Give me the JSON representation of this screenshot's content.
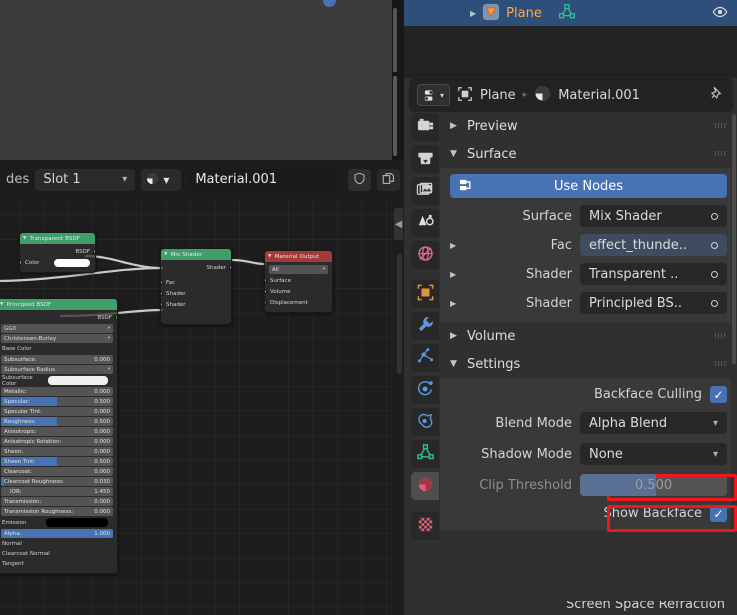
{
  "viewport": {
    "name": "3d-viewport",
    "object_outline_color": "#ff8226",
    "object_fill_color": "#b0bf4b",
    "background_color": "#3c3c3c"
  },
  "shader_editor": {
    "header": {
      "truncated_label": "des",
      "slot_selector": "Slot 1",
      "material_name": "Material.001",
      "fake_user_icon": "shield-icon",
      "new_material_icon": "copy-icon",
      "browse_material_icon": "material-sphere-icon"
    },
    "nodes": [
      {
        "id": "transparent-bsdf",
        "title": "Transparent BSDF",
        "header_color": "#3f9e69",
        "outputs": [
          "BSDF"
        ],
        "color_label": "Color",
        "color_value": "#ffffff"
      },
      {
        "id": "mix-shader",
        "title": "Mix Shader",
        "header_color": "#3f9e69",
        "outputs": [
          "Shader"
        ],
        "inputs": [
          "Fac",
          "Shader",
          "Shader"
        ]
      },
      {
        "id": "material-output",
        "title": "Material Output",
        "header_color": "#a33a3a",
        "target": "All",
        "inputs": [
          "Surface",
          "Volume",
          "Displacement"
        ]
      },
      {
        "id": "principled-bsdf",
        "title": "Principled BSDF",
        "header_color": "#3f9e69",
        "outputs": [
          "BSDF"
        ],
        "distribution": "GGX",
        "subsurface_method": "Christensen-Burley",
        "properties": [
          {
            "label": "Base Color",
            "type": "label"
          },
          {
            "label": "Subsurface:",
            "value": "0.000",
            "type": "slider",
            "fill": 0
          },
          {
            "label": "Subsurface Radius",
            "type": "dropdown"
          },
          {
            "label": "Subsurface Color",
            "type": "color",
            "color": "#f0f0ee"
          },
          {
            "label": "Metallic:",
            "value": "0.000",
            "type": "slider",
            "fill": 0
          },
          {
            "label": "Specular:",
            "value": "0.500",
            "type": "slider",
            "fill": 50
          },
          {
            "label": "Specular Tint:",
            "value": "0.000",
            "type": "slider",
            "fill": 0
          },
          {
            "label": "Roughness:",
            "value": "0.500",
            "type": "slider",
            "fill": 50
          },
          {
            "label": "Anisotropic:",
            "value": "0.000",
            "type": "slider",
            "fill": 0
          },
          {
            "label": "Anisotropic Rotation:",
            "value": "0.000",
            "type": "slider",
            "fill": 0
          },
          {
            "label": "Sheen:",
            "value": "0.000",
            "type": "slider",
            "fill": 0
          },
          {
            "label": "Sheen Tint:",
            "value": "0.500",
            "type": "slider",
            "fill": 50
          },
          {
            "label": "Clearcoat:",
            "value": "0.000",
            "type": "slider",
            "fill": 0
          },
          {
            "label": "Clearcoat Roughness:",
            "value": "0.030",
            "type": "slider",
            "fill": 3
          },
          {
            "label": "IOR:",
            "value": "1.450",
            "type": "slider",
            "fill": 0
          },
          {
            "label": "Transmission:",
            "value": "0.000",
            "type": "slider",
            "fill": 0
          },
          {
            "label": "Transmission Roughness:",
            "value": "0.000",
            "type": "slider",
            "fill": 0
          },
          {
            "label": "Emission",
            "type": "color",
            "color": "#000000"
          },
          {
            "label": "Alpha:",
            "value": "1.000",
            "type": "slider",
            "fill": 100
          },
          {
            "label": "Normal",
            "type": "label"
          },
          {
            "label": "Clearcoat Normal",
            "type": "label"
          },
          {
            "label": "Tangent",
            "type": "label"
          }
        ]
      }
    ]
  },
  "outliner": {
    "object_name": "Plane",
    "object_icon": "mesh-triangle-icon",
    "data_icon": "mesh-data-icon",
    "visibility_icon": "eye-icon",
    "highlight_color": "#2d4f79",
    "name_color": "#ffa94d"
  },
  "properties": {
    "breadcrumb": {
      "editor_icon": "properties-editor-icon",
      "object_icon": "object-data-icon",
      "object_name": "Plane",
      "separator": "▸",
      "material_icon": "material-sphere-icon",
      "material_name": "Material.001",
      "pin_icon": "pin-icon"
    },
    "tabs": [
      {
        "name": "tool",
        "icon": "tool-icon",
        "color": "#d0d0d0",
        "active": false
      },
      {
        "name": "render",
        "icon": "camera-back-icon",
        "color": "#d0d0d0",
        "active": false
      },
      {
        "name": "output",
        "icon": "printer-icon",
        "color": "#d0d0d0",
        "active": false
      },
      {
        "name": "view-layer",
        "icon": "images-icon",
        "color": "#d0d0d0",
        "active": false
      },
      {
        "name": "scene",
        "icon": "scene-cone-icon",
        "color": "#d0d0d0",
        "active": false
      },
      {
        "name": "world",
        "icon": "world-globe-icon",
        "color": "#e06c8a",
        "active": false
      },
      {
        "name": "object",
        "icon": "object-square-icon",
        "color": "#e0943c",
        "active": false
      },
      {
        "name": "modifiers",
        "icon": "wrench-icon",
        "color": "#5b9ae0",
        "active": false
      },
      {
        "name": "particles",
        "icon": "particles-icon",
        "color": "#5b9ae0",
        "active": false
      },
      {
        "name": "physics",
        "icon": "physics-orbit-icon",
        "color": "#5b9ae0",
        "active": false
      },
      {
        "name": "constraints",
        "icon": "constraint-icon",
        "color": "#5b9ae0",
        "active": false
      },
      {
        "name": "object-data",
        "icon": "mesh-data-icon",
        "color": "#3fbf8f",
        "active": false
      },
      {
        "name": "material",
        "icon": "material-sphere-icon",
        "color": "#e0607a",
        "active": true
      },
      {
        "name": "texture",
        "icon": "checker-texture-icon",
        "color": "#e0607a",
        "active": false
      }
    ],
    "panels": {
      "preview": {
        "title": "Preview",
        "expanded": false
      },
      "surface": {
        "title": "Surface",
        "expanded": true,
        "use_nodes_button": "Use Nodes",
        "rows": [
          {
            "label": "Surface",
            "value": "Mix Shader",
            "expandable": false,
            "linked": false
          },
          {
            "label": "Fac",
            "value": "effect_thunde..",
            "expandable": true,
            "linked": true
          },
          {
            "label": "Shader",
            "value": "Transparent ..",
            "expandable": true,
            "linked": false
          },
          {
            "label": "Shader",
            "value": "Principled BS..",
            "expandable": true,
            "linked": false
          }
        ]
      },
      "volume": {
        "title": "Volume",
        "expanded": false
      },
      "settings": {
        "title": "Settings",
        "expanded": true,
        "backface_culling": {
          "label": "Backface Culling",
          "checked": true
        },
        "blend_mode": {
          "label": "Blend Mode",
          "value": "Alpha Blend",
          "highlighted": true
        },
        "shadow_mode": {
          "label": "Shadow Mode",
          "value": "None",
          "highlighted": true
        },
        "clip_threshold": {
          "label": "Clip Threshold",
          "value": "0.500",
          "disabled": true
        },
        "show_backface": {
          "label": "Show Backface",
          "checked": true
        },
        "screen_space_refraction": {
          "label": "Screen Space Refraction",
          "checked": false
        }
      }
    },
    "highlight_color": "#f4141b",
    "accent_color": "#4772b3"
  }
}
